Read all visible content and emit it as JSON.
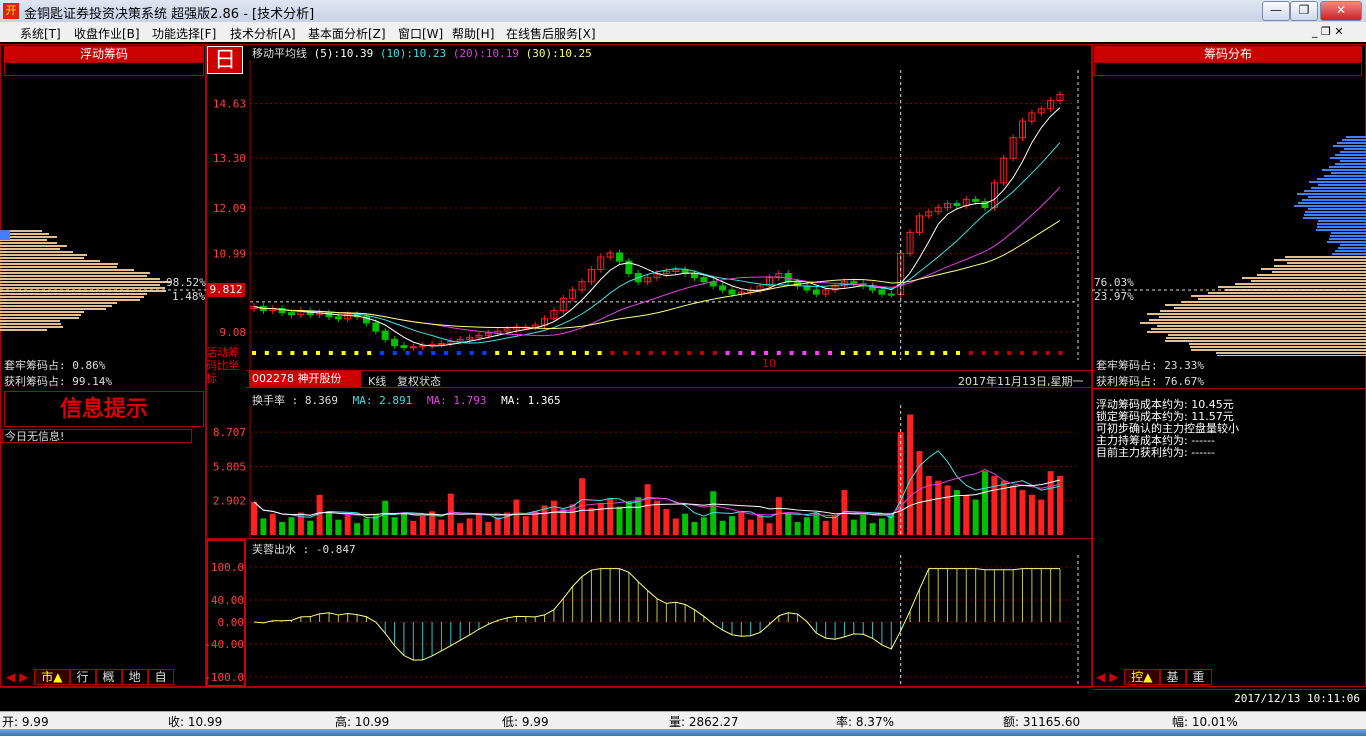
{
  "window": {
    "title": "金铜匙证券投资决策系统 超强版2.86 - [技术分析]",
    "minimize": "—",
    "restore": "❐",
    "close": "✕"
  },
  "menu": {
    "items": [
      "系统[T]",
      "收盘作业[B]",
      "功能选择[F]",
      "技术分析[A]",
      "基本面分析[Z]",
      "窗口[W]",
      "帮助[H]",
      "在线售后服务[X]"
    ],
    "mdi_controls": "_ ❐ ✕"
  },
  "left_panel": {
    "header": "浮动筹码",
    "pct_upper": "98.52%",
    "pct_lower": "1.48%",
    "trapped_label": "套牢筹码占: 0.86%",
    "profit_label": "获利筹码占: 99.14%",
    "info_title": "信息提示",
    "info_text": "今日无信息!",
    "tabs": [
      "市▲",
      "行",
      "概",
      "地",
      "自"
    ]
  },
  "right_panel": {
    "header": "筹码分布",
    "pct_upper": "76.03%",
    "pct_lower": "23.97%",
    "trapped_label": "套牢筹码占: 23.33%",
    "profit_label": "获利筹码占: 76.67%",
    "info_lines": [
      "浮动筹码成本约为: 10.45元",
      "锁定筹码成本约为: 11.57元",
      "可初步确认的主力控盘量较小",
      "主力持筹成本约为: ------",
      "目前主力获利约为: ------"
    ],
    "tabs": [
      "控▲",
      "基",
      "重"
    ],
    "datetime": "2017/12/13  10:11:06"
  },
  "main_chart": {
    "period_badge": "日",
    "ma_title": "移动平均线",
    "ma5": "(5):10.39",
    "ma10": "(10):10.23",
    "ma20": "(20):10.19",
    "ma30": "(30):10.25",
    "price_ticks": [
      "14.63",
      "13.30",
      "12.09",
      "10.99",
      "9.08"
    ],
    "current_price": "9.812",
    "active_label": "活动筹码比坐标",
    "month_marker": "10",
    "stock_code": "002278",
    "stock_name": "神开股份",
    "k_line": "K线",
    "adjust": "复权状态",
    "date": "2017年11月13日,星期一"
  },
  "volume_chart": {
    "title": "换手率",
    "value": ": 8.369",
    "ma1": "MA: 2.891",
    "ma2": "MA: 1.793",
    "ma3": "MA: 1.365",
    "ticks": [
      "8.707",
      "5.805",
      "2.902"
    ]
  },
  "indicator_chart": {
    "title": "芙蓉出水",
    "value": ": -0.847",
    "ticks": [
      "100.0",
      "40.00",
      "0.00",
      "-40.00",
      "-100.0"
    ]
  },
  "status_bar": {
    "open": "开: 9.99",
    "close": "收: 10.99",
    "high": "高: 10.99",
    "low": "低: 9.99",
    "volume": "量: 2862.27",
    "rate": "率: 8.37%",
    "amount": "额: 31165.60",
    "change": "幅: 10.01%"
  },
  "colors": {
    "up": "#ff2020",
    "down": "#00c000",
    "ma5": "#ffffff",
    "ma10": "#40e0e0",
    "ma20": "#e040e0",
    "ma30": "#ffff80",
    "grid": "#800000"
  },
  "chart_data": {
    "type": "candlestick",
    "closes": [
      9.7,
      9.6,
      9.65,
      9.55,
      9.5,
      9.6,
      9.5,
      9.55,
      9.45,
      9.4,
      9.5,
      9.45,
      9.3,
      9.1,
      8.9,
      8.75,
      8.7,
      8.72,
      8.75,
      8.78,
      8.8,
      8.85,
      8.9,
      8.95,
      9.0,
      9.05,
      9.1,
      9.15,
      9.2,
      9.2,
      9.25,
      9.4,
      9.6,
      9.9,
      10.1,
      10.3,
      10.6,
      10.9,
      11.0,
      10.8,
      10.5,
      10.3,
      10.4,
      10.5,
      10.55,
      10.6,
      10.5,
      10.4,
      10.3,
      10.2,
      10.1,
      10.0,
      10.05,
      10.1,
      10.2,
      10.4,
      10.5,
      10.3,
      10.2,
      10.1,
      10.0,
      10.1,
      10.2,
      10.3,
      10.25,
      10.2,
      10.1,
      10.0,
      9.99,
      10.99,
      11.5,
      11.9,
      12.0,
      12.1,
      12.2,
      12.15,
      12.3,
      12.25,
      12.1,
      12.7,
      13.3,
      13.8,
      14.2,
      14.4,
      14.5,
      14.7,
      14.85
    ]
  }
}
